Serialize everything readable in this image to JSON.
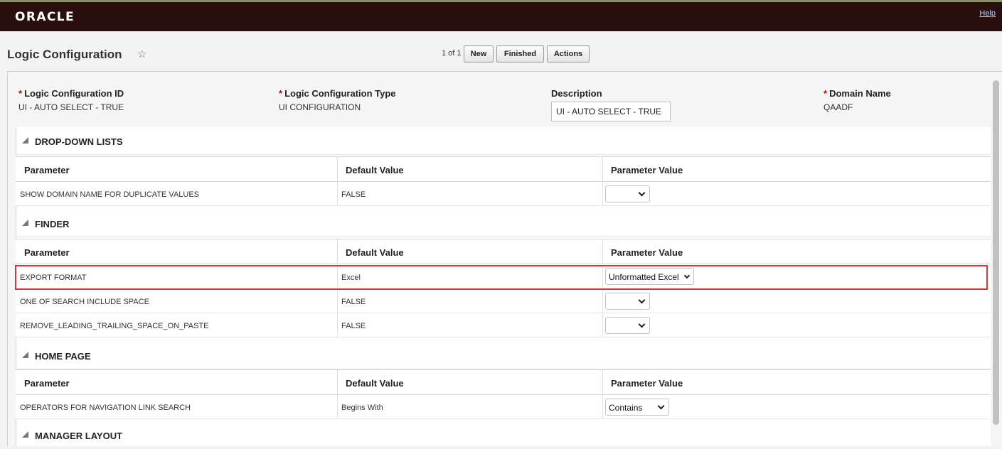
{
  "brand": {
    "logo": "ORACLE",
    "help_link": "Help"
  },
  "header": {
    "title": "Logic Configuration",
    "star_icon": "☆",
    "pager": "1 of 1",
    "buttons": {
      "new": "New",
      "finished": "Finished",
      "actions": "Actions"
    }
  },
  "form": {
    "required_marker": "*",
    "logic_configuration_id": {
      "label": "Logic Configuration ID",
      "value": "UI - AUTO SELECT - TRUE"
    },
    "logic_configuration_type": {
      "label": "Logic Configuration Type",
      "value": "UI CONFIGURATION"
    },
    "description": {
      "label": "Description",
      "value": "UI - AUTO SELECT - TRUE"
    },
    "domain_name": {
      "label": "Domain Name",
      "value": "QAADF"
    }
  },
  "columns": {
    "parameter": "Parameter",
    "default_value": "Default Value",
    "parameter_value": "Parameter Value"
  },
  "sections": {
    "dropdown_lists": {
      "title": "DROP-DOWN LISTS",
      "rows": [
        {
          "parameter": "SHOW DOMAIN NAME FOR DUPLICATE VALUES",
          "default": "FALSE",
          "value": ""
        }
      ]
    },
    "finder": {
      "title": "FINDER",
      "rows": [
        {
          "parameter": "EXPORT FORMAT",
          "default": "Excel",
          "value": "Unformatted Excel"
        },
        {
          "parameter": "ONE OF SEARCH INCLUDE SPACE",
          "default": "FALSE",
          "value": ""
        },
        {
          "parameter": "REMOVE_LEADING_TRAILING_SPACE_ON_PASTE",
          "default": "FALSE",
          "value": ""
        }
      ]
    },
    "home_page": {
      "title": "HOME PAGE",
      "rows": [
        {
          "parameter": "OPERATORS FOR NAVIGATION LINK SEARCH",
          "default": "Begins With",
          "value": "Contains"
        }
      ]
    },
    "manager_layout": {
      "title": "MANAGER LAYOUT"
    }
  },
  "colors": {
    "brand_bar": "#2a0f0f",
    "highlight": "#e0342b",
    "required": "#cc0000"
  }
}
